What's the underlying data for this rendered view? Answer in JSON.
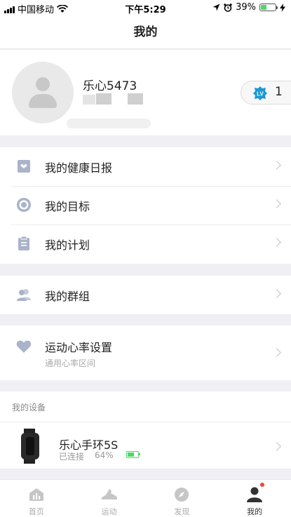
{
  "status_bar": {
    "carrier": "中国移动",
    "time": "下午5:29",
    "battery": "39%"
  },
  "header": {
    "title": "我的"
  },
  "profile": {
    "username": "乐心5473",
    "level": "1"
  },
  "menu_group_1": [
    {
      "label": "我的健康日报",
      "icon": "health-report-icon"
    },
    {
      "label": "我的目标",
      "icon": "target-icon"
    },
    {
      "label": "我的计划",
      "icon": "clipboard-icon"
    }
  ],
  "menu_group_2": [
    {
      "label": "我的群组",
      "icon": "group-icon"
    }
  ],
  "heart_rate": {
    "label": "运动心率设置",
    "sublabel": "通用心率区间"
  },
  "devices": {
    "section_title": "我的设备",
    "items": [
      {
        "name": "乐心手环5S",
        "status": "已连接",
        "battery": "64%"
      }
    ]
  },
  "tabbar": [
    {
      "label": "首页",
      "icon": "home-chart-icon"
    },
    {
      "label": "运动",
      "icon": "shoe-icon"
    },
    {
      "label": "发现",
      "icon": "compass-icon"
    },
    {
      "label": "我的",
      "icon": "person-icon",
      "active": true
    }
  ],
  "colors": {
    "accent": "#1a98d5",
    "icon_gray": "#a9b3c9",
    "battery_green": "#4cd964",
    "badge_dot": "#f0443c"
  }
}
